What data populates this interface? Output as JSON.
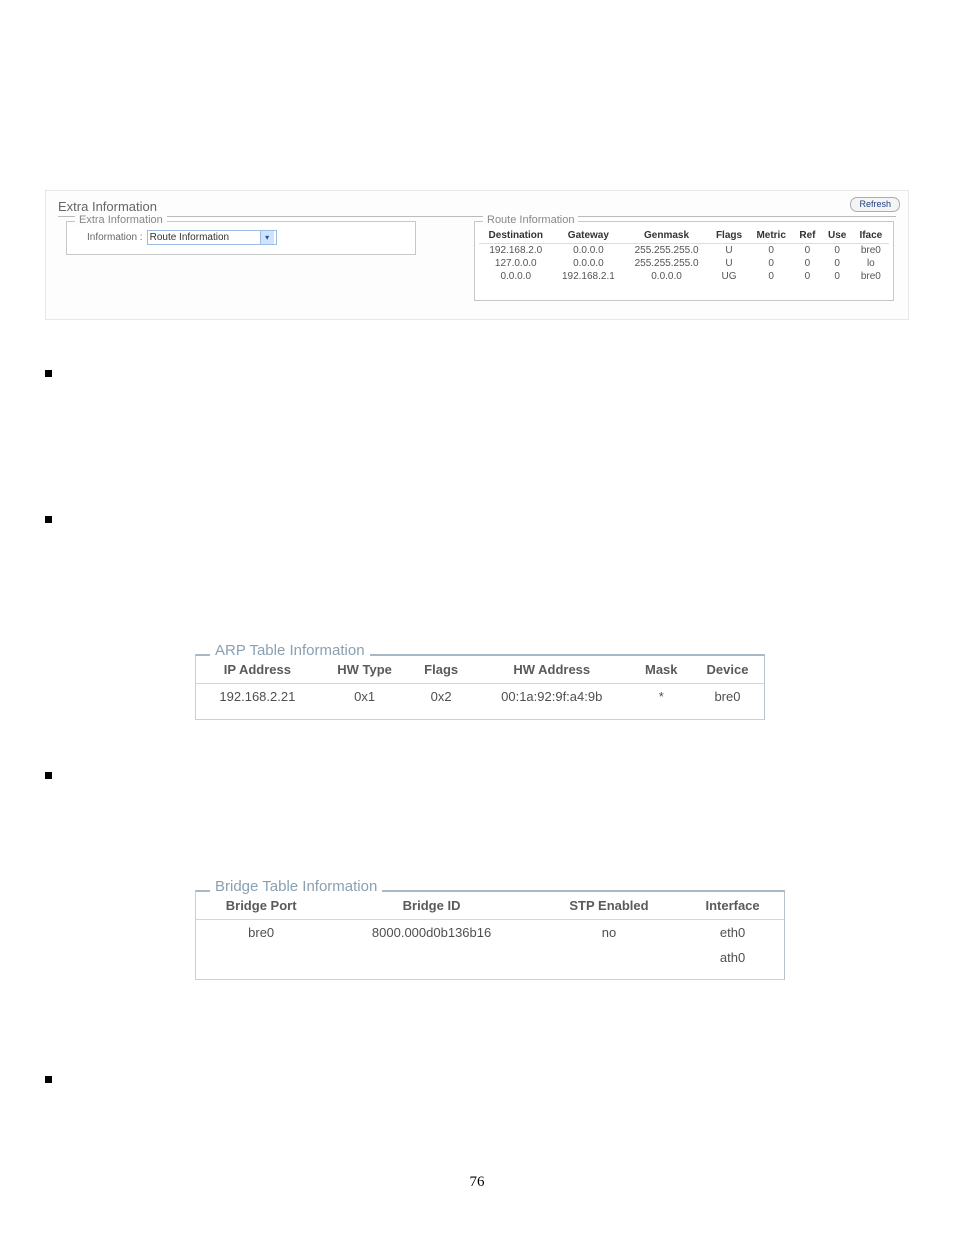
{
  "page_number": "76",
  "top_panel": {
    "title": "Extra Information",
    "refresh_label": "Refresh",
    "left": {
      "legend": "Extra Information",
      "field_label": "Information :",
      "select_value": "Route Information"
    },
    "route": {
      "legend": "Route Information",
      "headers": [
        "Destination",
        "Gateway",
        "Genmask",
        "Flags",
        "Metric",
        "Ref",
        "Use",
        "Iface"
      ],
      "rows": [
        [
          "192.168.2.0",
          "0.0.0.0",
          "255.255.255.0",
          "U",
          "0",
          "0",
          "0",
          "bre0"
        ],
        [
          "127.0.0.0",
          "0.0.0.0",
          "255.255.255.0",
          "U",
          "0",
          "0",
          "0",
          "lo"
        ],
        [
          "0.0.0.0",
          "192.168.2.1",
          "0.0.0.0",
          "UG",
          "0",
          "0",
          "0",
          "bre0"
        ]
      ]
    }
  },
  "arp": {
    "legend": "ARP Table Information",
    "headers": [
      "IP Address",
      "HW Type",
      "Flags",
      "HW Address",
      "Mask",
      "Device"
    ],
    "rows": [
      [
        "192.168.2.21",
        "0x1",
        "0x2",
        "00:1a:92:9f:a4:9b",
        "*",
        "bre0"
      ]
    ]
  },
  "bridge": {
    "legend": "Bridge Table Information",
    "headers": [
      "Bridge Port",
      "Bridge ID",
      "STP Enabled",
      "Interface"
    ],
    "rows": [
      [
        "bre0",
        "8000.000d0b136b16",
        "no",
        "eth0"
      ],
      [
        "",
        "",
        "",
        "ath0"
      ]
    ]
  }
}
